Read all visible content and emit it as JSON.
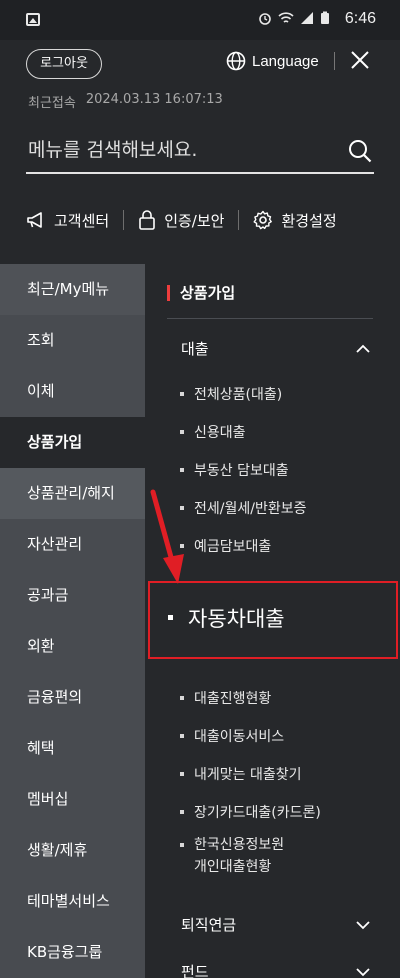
{
  "status_bar": {
    "time": "6:46"
  },
  "header": {
    "logout_label": "로그아웃",
    "language_label": "Language",
    "last_access_label": "최근접속",
    "last_access_time": "2024.03.13 16:07:13",
    "search_placeholder": "메뉴를 검색해보세요.",
    "quick_links": [
      "고객센터",
      "인증/보안",
      "환경설정"
    ]
  },
  "left_nav": {
    "items": [
      "최근/My메뉴",
      "조회",
      "이체",
      "상품가입",
      "상품관리/해지",
      "자산관리",
      "공과금",
      "외환",
      "금융편의",
      "혜택",
      "멤버십",
      "생활/제휴",
      "테마별서비스",
      "KB금융그룹"
    ],
    "active": "상품가입"
  },
  "content": {
    "section_title": "상품가입",
    "groups": [
      {
        "title": "대출",
        "expanded": true,
        "items": [
          "전체상품(대출)",
          "신용대출",
          "부동산 담보대출",
          "전세/월세/반환보증",
          "예금담보대출",
          "자동차대출",
          "대출진행현황",
          "대출이동서비스",
          "내게맞는 대출찾기",
          "장기카드대출(카드론)",
          "한국신용정보원",
          "개인대출현황"
        ]
      },
      {
        "title": "퇴직연금",
        "expanded": false
      },
      {
        "title": "펀드",
        "expanded": false
      }
    ],
    "highlighted_item": "자동차대출"
  },
  "colors": {
    "background": "#26282b",
    "left_nav_bg": "#484b50",
    "accent_red": "#e01e25",
    "section_bar": "#ee3d3d"
  }
}
